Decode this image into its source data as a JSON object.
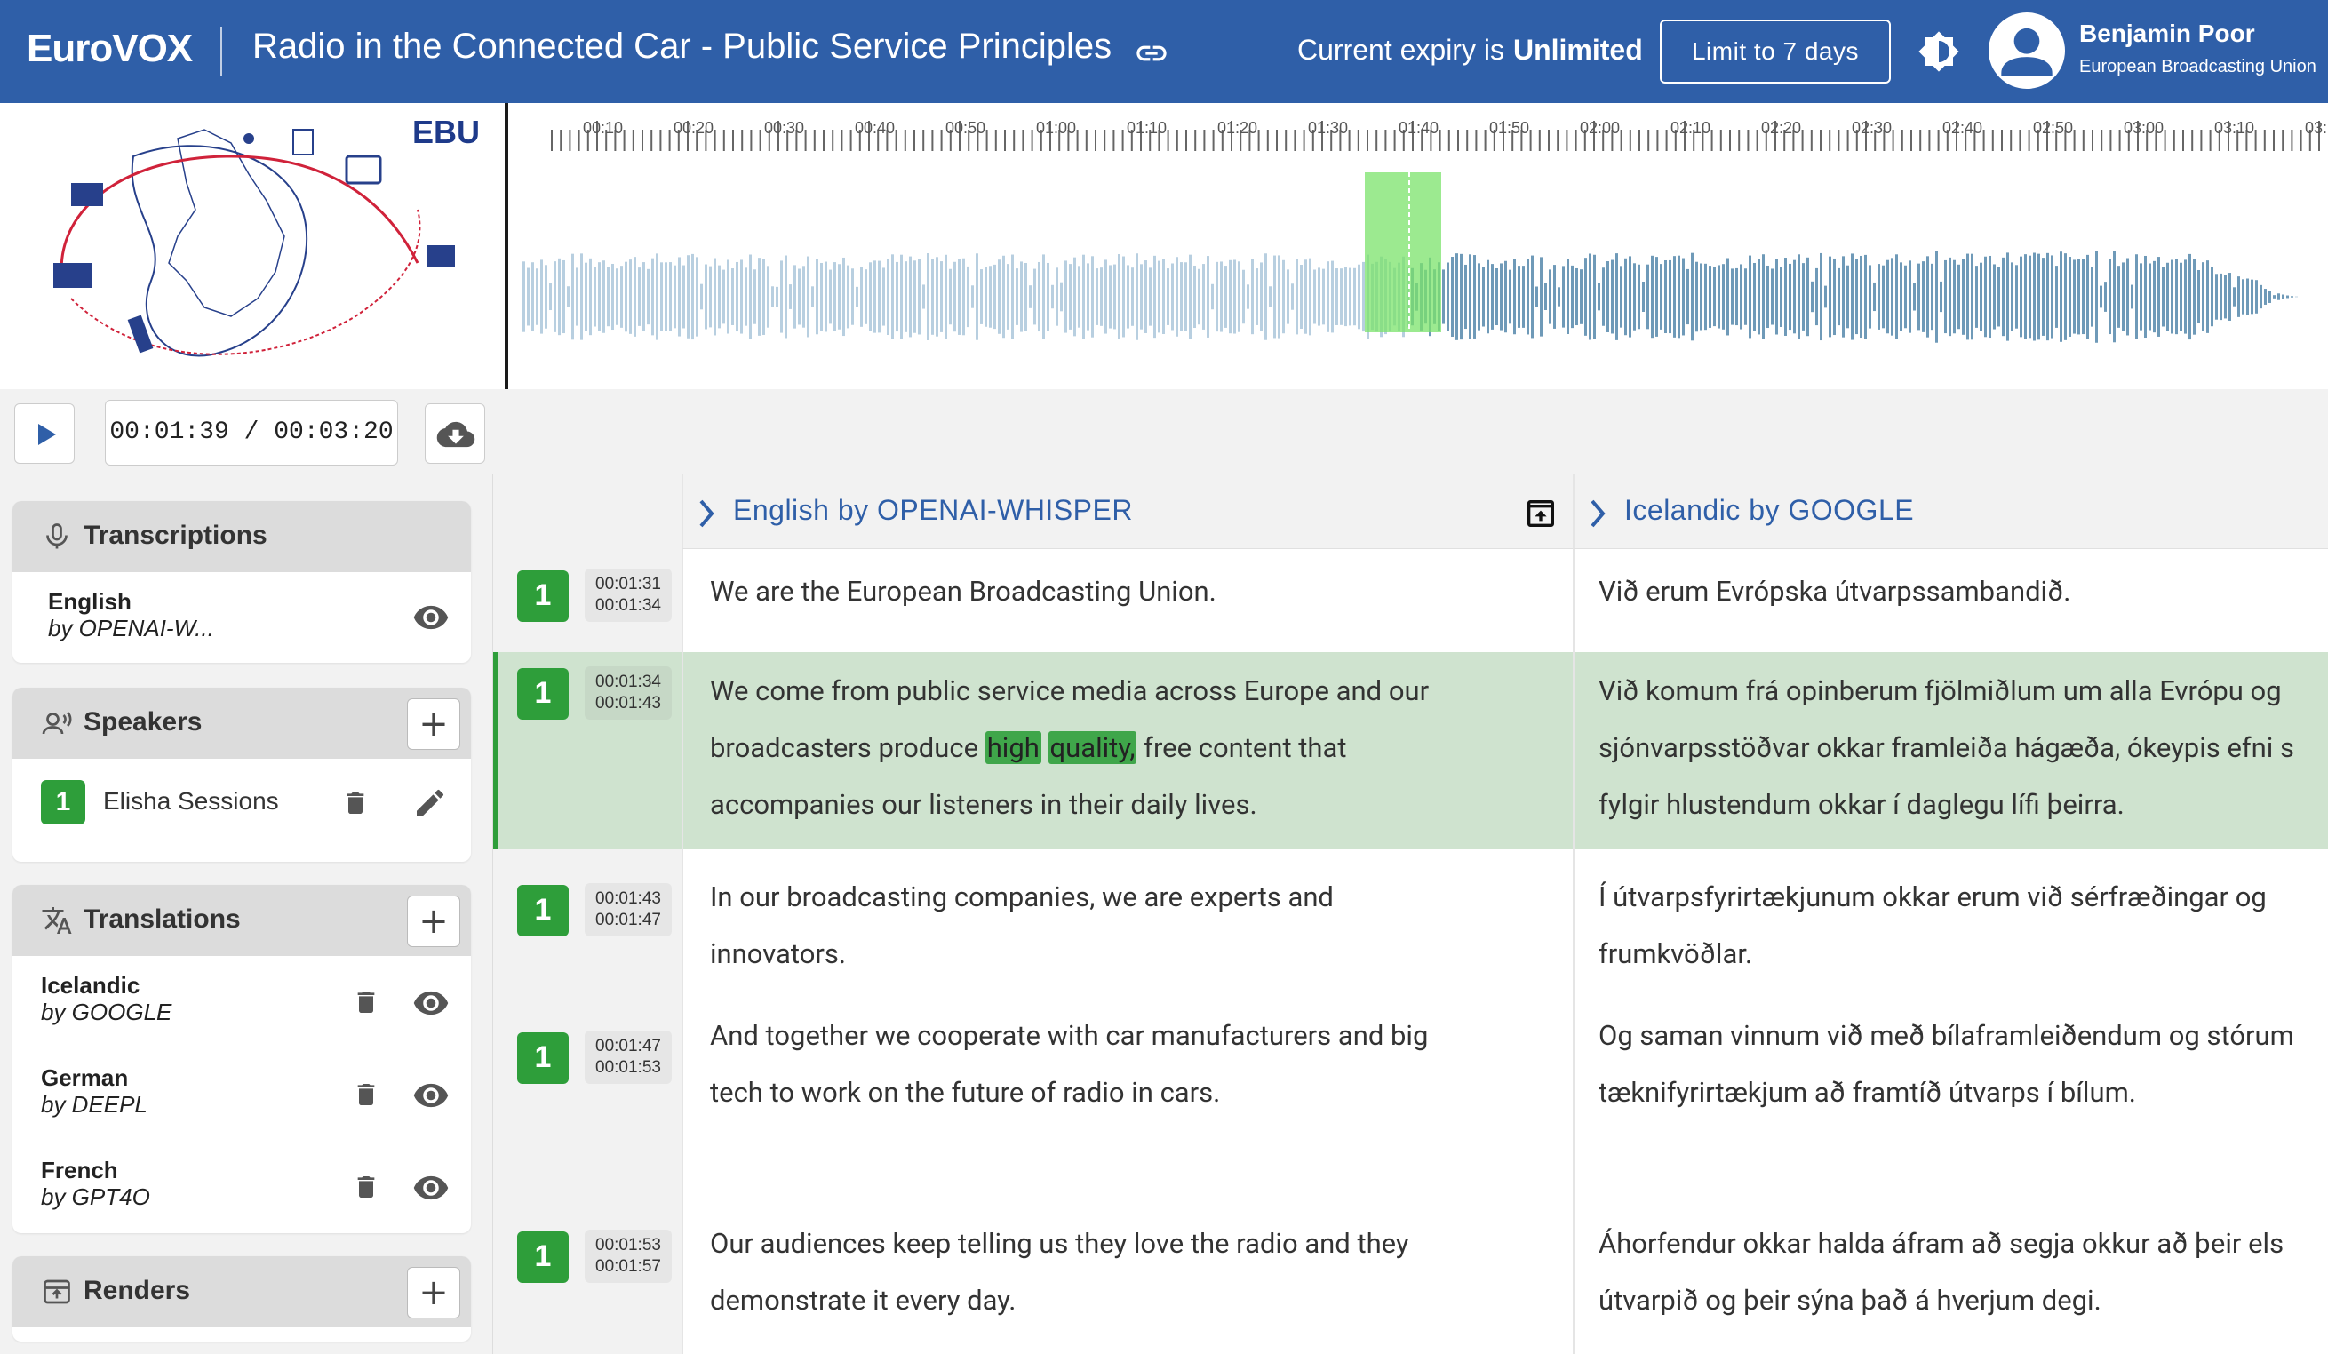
{
  "header": {
    "logo": "EuroVOX",
    "title": "Radio in the Connected Car - Public Service Principles",
    "expiry_label": "Current expiry is",
    "expiry_value": "Unlimited",
    "limit_button": "Limit to 7 days",
    "user_name": "Benjamin Poor",
    "user_org": "European Broadcasting Union"
  },
  "thumbnail": {
    "label": "EBU"
  },
  "waveform": {
    "ticks": [
      "00:10",
      "00:20",
      "00:30",
      "00:40",
      "00:50",
      "01:00",
      "01:10",
      "01:20",
      "01:30",
      "01:40",
      "01:50",
      "02:00",
      "02:10",
      "02:20",
      "02:30",
      "02:40",
      "02:50",
      "03:00",
      "03:10",
      "03:"
    ]
  },
  "player": {
    "current": "00:01:39",
    "separator": "/",
    "total": "00:03:20"
  },
  "sidebar": {
    "transcriptions": {
      "title": "Transcriptions",
      "items": [
        {
          "name": "English",
          "by": "by OPENAI-W..."
        }
      ]
    },
    "speakers": {
      "title": "Speakers",
      "items": [
        {
          "id": "1",
          "name": "Elisha Sessions"
        }
      ]
    },
    "translations": {
      "title": "Translations",
      "items": [
        {
          "name": "Icelandic",
          "by": "by GOOGLE"
        },
        {
          "name": "German",
          "by": "by DEEPL"
        },
        {
          "name": "French",
          "by": "by GPT4O"
        }
      ]
    },
    "renders": {
      "title": "Renders"
    }
  },
  "columns": {
    "source": "English by OPENAI-WHISPER",
    "translation": "Icelandic by GOOGLE"
  },
  "segments": [
    {
      "speaker": "1",
      "start": "00:01:31",
      "end": "00:01:34",
      "en": "We are the European Broadcasting Union.",
      "is": "Við erum Evrópska útvarpssambandið."
    },
    {
      "speaker": "1",
      "start": "00:01:34",
      "end": "00:01:43",
      "en_line1": "We come from public service media across Europe and our",
      "en_line2_pre": "broadcasters produce",
      "en_hl1": "high",
      "en_hl2": "quality,",
      "en_line2_post": "free content that",
      "en_line3": "accompanies our listeners in their daily lives.",
      "is_line1": "Við komum frá opinberum fjölmiðlum um alla Evrópu og",
      "is_line2": "sjónvarpsstöðvar okkar framleiða hágæða, ókeypis efni s",
      "is_line3": "fylgir hlustendum okkar í daglegu lífi þeirra."
    },
    {
      "speaker": "1",
      "start": "00:01:43",
      "end": "00:01:47",
      "en_line1": "In our broadcasting companies, we are experts and",
      "en_line2": "innovators.",
      "is_line1": "Í útvarpsfyrirtækjunum okkar erum við sérfræðingar og",
      "is_line2": "frumkvöðlar."
    },
    {
      "speaker": "1",
      "start": "00:01:47",
      "end": "00:01:53",
      "en_line1": "And together we cooperate with car manufacturers and big",
      "en_line2": "tech to work on the future of radio in cars.",
      "is_line1": "Og saman vinnum við með bílaframleiðendum og stórum",
      "is_line2": "tæknifyrirtækjum að framtíð útvarps í bílum."
    },
    {
      "speaker": "1",
      "start": "00:01:53",
      "end": "00:01:57",
      "en_line1": "Our audiences keep telling us they love the radio and they",
      "en_line2": "demonstrate it every day.",
      "is_line1": "Áhorfendur okkar halda áfram að segja okkur að þeir els",
      "is_line2": "útvarpið og þeir sýna það á hverjum degi."
    }
  ],
  "colors": {
    "header": "#2f5fa8",
    "accent_green": "#2e9e3a",
    "active_row": "#cfe3cf",
    "column_title": "#2f5fa8"
  }
}
